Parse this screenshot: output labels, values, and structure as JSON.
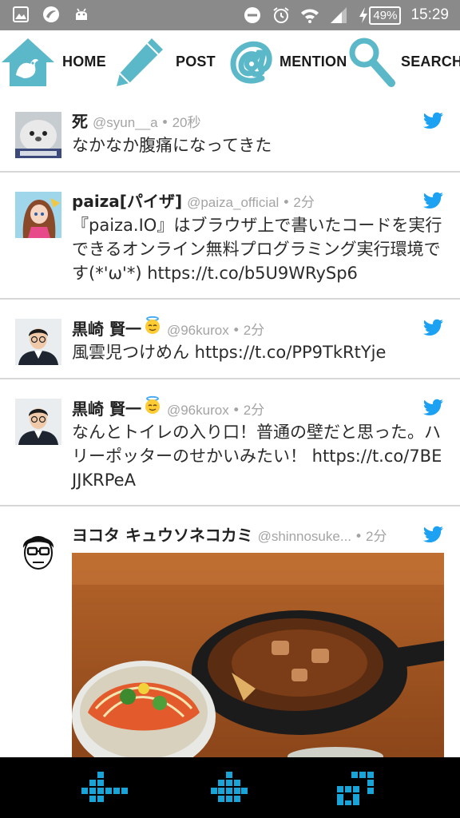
{
  "status_bar": {
    "battery": "49%",
    "time": "15:29"
  },
  "nav": {
    "home": "HOME",
    "post": "POST",
    "mention": "MENTION",
    "search": "SEARCH"
  },
  "tweets": [
    {
      "name": "死",
      "handle": "@syun__a",
      "dot": "•",
      "time": "20秒",
      "text": "なかなか腹痛になってきた",
      "avatar_icon": "seal-plush-avatar"
    },
    {
      "name": "paiza[パイザ]",
      "handle": "@paiza_official",
      "dot": "•",
      "time": "2分",
      "text": "『paiza.IO』はブラウザ上で書いたコードを実行できるオンライン無料プログラミング実行環境です(*'ω'*) https://t.co/b5U9WRySp6",
      "avatar_icon": "anime-girl-avatar"
    },
    {
      "name": "黒崎 賢一",
      "handle": "@96kurox",
      "dot": "•",
      "time": "2分",
      "text": "風雲児つけめん https://t.co/PP9TkRtYje",
      "avatar_icon": "man-portrait-avatar"
    },
    {
      "name": "黒崎 賢一",
      "handle": "@96kurox",
      "dot": "•",
      "time": "2分",
      "text": "なんとトイレの入り口！普通の壁だと思った。ハリーポッターのせかいみたい！ https://t.co/7BEJJKRPeA",
      "avatar_icon": "man-portrait-avatar"
    },
    {
      "name": "ヨコタ キュウソネコカミ",
      "handle": "@shinnosuke...",
      "dot": "•",
      "time": "2分",
      "text": "",
      "avatar_icon": "cartoon-glasses-avatar",
      "media": "food-photo"
    }
  ],
  "colors": {
    "accent": "#5bb8c9",
    "twitter_blue": "#1da1f2",
    "status_bar": "#8a8a8a",
    "bottom_bar": "#000000",
    "bottom_icons": "#1aa3d6",
    "divider": "#d7d7d7"
  },
  "bottom_bar": {
    "buttons": [
      "back-arrow-icon",
      "home-icon",
      "recent-apps-icon"
    ]
  }
}
